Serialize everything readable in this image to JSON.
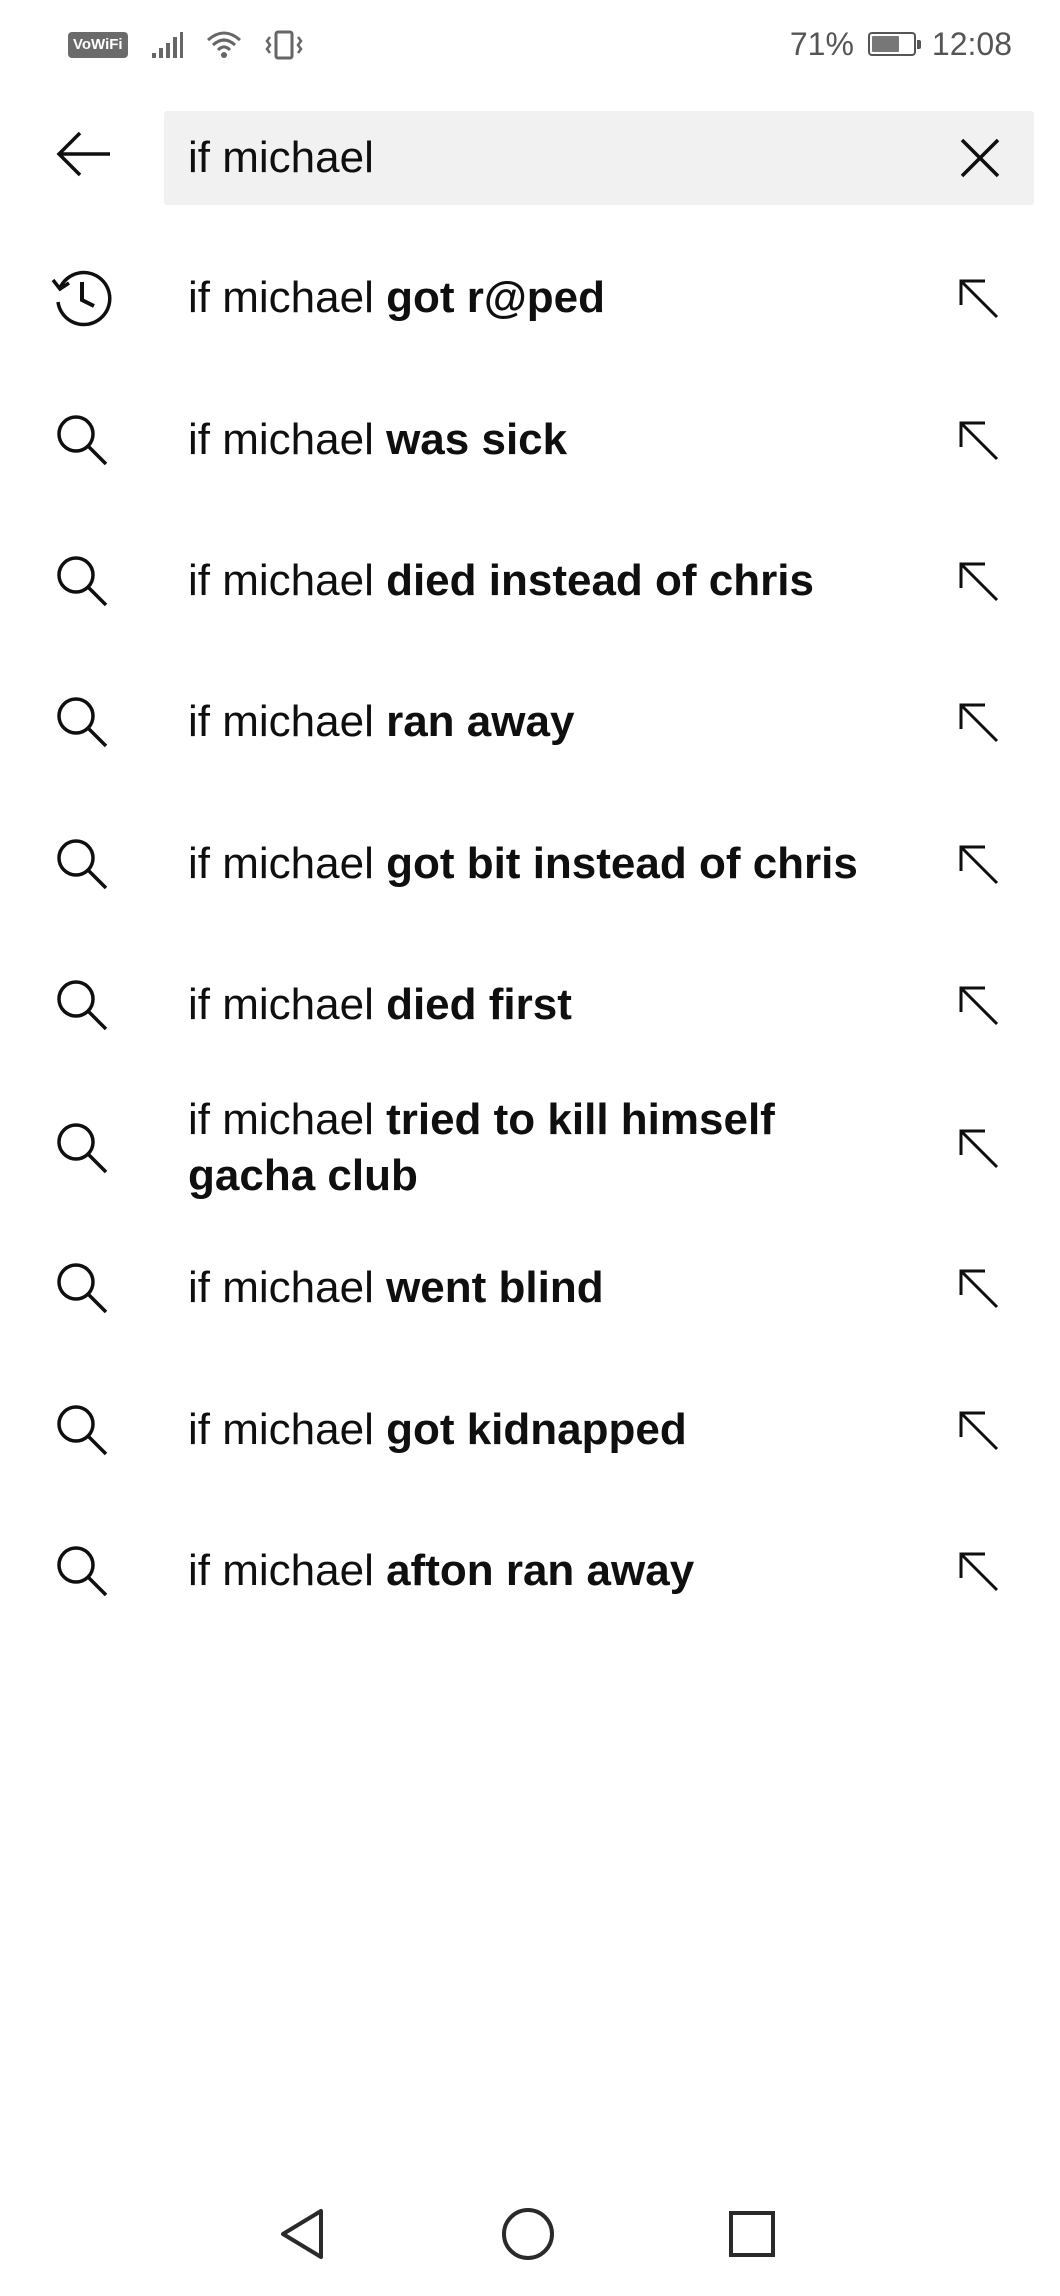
{
  "status_bar": {
    "vowifi_label": "VoWiFi",
    "battery_text": "71%",
    "battery_level": 0.71,
    "time": "12:08",
    "icons": [
      "vowifi-icon",
      "signal-icon",
      "wifi-icon",
      "vibrate-icon",
      "battery-icon"
    ]
  },
  "search": {
    "value": "if michael",
    "back_icon": "arrow-left-icon",
    "clear_icon": "close-icon"
  },
  "suggestions": [
    {
      "icon": "history-icon",
      "query": "if michael",
      "completion": "got r@ped"
    },
    {
      "icon": "search-icon",
      "query": "if michael",
      "completion": "was sick"
    },
    {
      "icon": "search-icon",
      "query": "if michael",
      "completion": "died instead of chris"
    },
    {
      "icon": "search-icon",
      "query": "if michael",
      "completion": "ran away"
    },
    {
      "icon": "search-icon",
      "query": "if michael",
      "completion": "got bit instead of chris"
    },
    {
      "icon": "search-icon",
      "query": "if michael",
      "completion": "died first"
    },
    {
      "icon": "search-icon",
      "query": "if michael",
      "completion": "tried to kill himself gacha club"
    },
    {
      "icon": "search-icon",
      "query": "if michael",
      "completion": "went blind"
    },
    {
      "icon": "search-icon",
      "query": "if michael",
      "completion": "got kidnapped"
    },
    {
      "icon": "search-icon",
      "query": "if michael",
      "completion": "afton ran away"
    }
  ],
  "nav_bar": {
    "icons": [
      "back-triangle-icon",
      "home-circle-icon",
      "recents-square-icon"
    ]
  },
  "colors": {
    "text": "#0f0f0f",
    "search_background": "#f1f1f1",
    "status_gray": "#555555"
  }
}
